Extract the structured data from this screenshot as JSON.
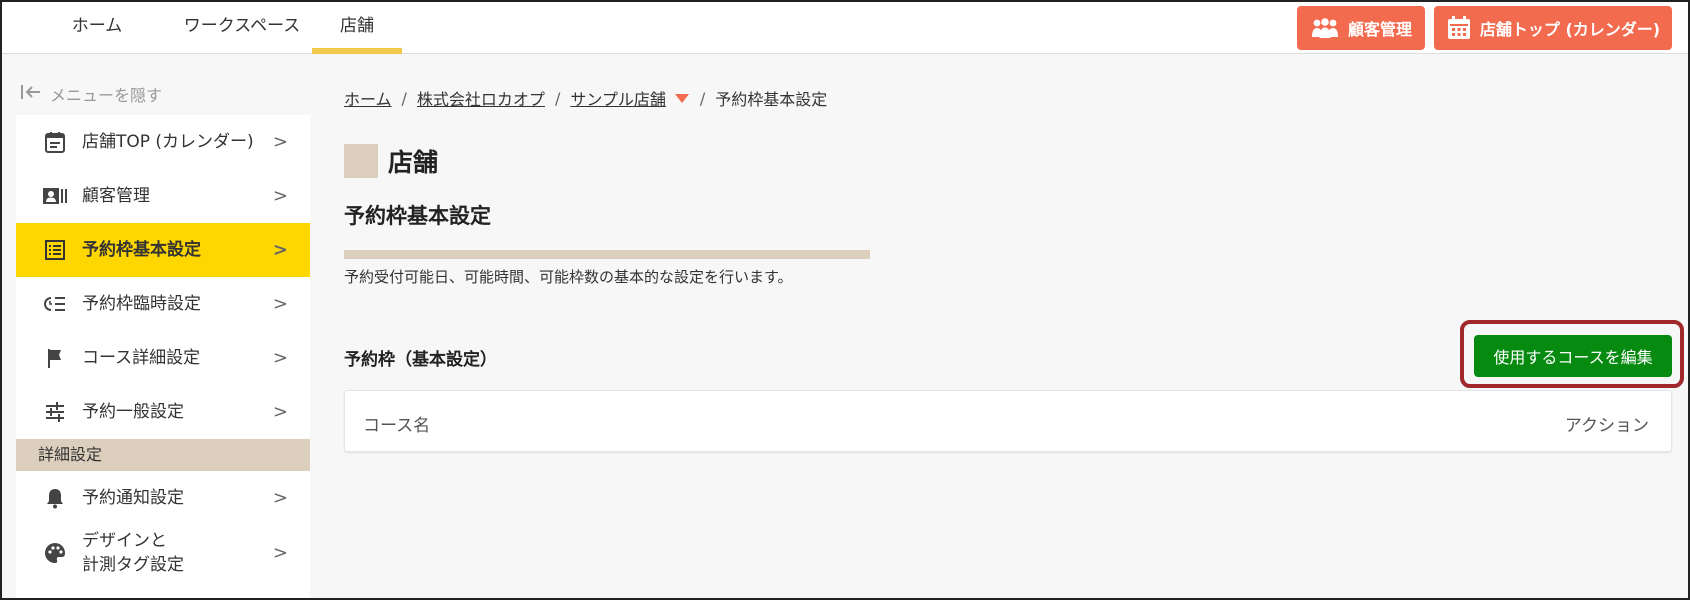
{
  "topbar": {
    "tabs": [
      {
        "label": "ホーム"
      },
      {
        "label": "ワークスペース"
      },
      {
        "label": "店舗"
      }
    ],
    "customer_button": {
      "label": "顧客管理",
      "icon": "people-icon"
    },
    "store_top_button": {
      "label": "店舗トップ (カレンダー)",
      "icon": "calendar-icon"
    }
  },
  "sidebar": {
    "hide_menu_label": "メニューを隠す",
    "items": [
      {
        "label": "店舗TOP (カレンダー)",
        "icon": "calendar-note-icon"
      },
      {
        "label": "顧客管理",
        "icon": "id-card-icon"
      },
      {
        "label": "予約枠基本設定",
        "icon": "list-box-icon"
      },
      {
        "label": "予約枠臨時設定",
        "icon": "list-clock-icon"
      },
      {
        "label": "コース詳細設定",
        "icon": "flag-icon"
      },
      {
        "label": "予約一般設定",
        "icon": "sliders-icon"
      }
    ],
    "section_label": "詳細設定",
    "detail_items": [
      {
        "label": "予約通知設定",
        "icon": "bell-icon"
      },
      {
        "label_line1": "デザインと",
        "label_line2": "計測タグ設定",
        "icon": "palette-icon"
      }
    ]
  },
  "breadcrumb": {
    "home": "ホーム",
    "company": "株式会社ロカオプ",
    "store": "サンプル店舗",
    "current": "予約枠基本設定",
    "separator": "/"
  },
  "main": {
    "page_title": "店舗",
    "sub_title": "予約枠基本設定",
    "description": "予約受付可能日、可能時間、可能枠数の基本的な設定を行います。",
    "section_title": "予約枠（基本設定）",
    "edit_button_label": "使用するコースを編集",
    "table_headers": {
      "left": "コース名",
      "right": "アクション"
    }
  },
  "colors": {
    "accent_orange": "#f36b4f",
    "active_yellow": "#ffd700",
    "beige": "#dccfbd",
    "green_button": "#078a10",
    "highlight_red": "#a0282b"
  }
}
